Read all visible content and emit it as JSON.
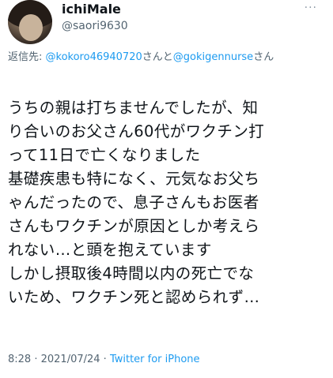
{
  "tweet": {
    "author": {
      "display_name": "ichiMale",
      "handle": "@saori9630"
    },
    "more_label": "···",
    "reply": {
      "prefix": "返信先: ",
      "mention1": "@kokoro46940720",
      "joiner": "さんと",
      "mention2": "@gokigennurse",
      "suffix": "さん"
    },
    "body_lines": [
      "うちの親は打ちませんでしたが、知",
      "り合いのお父さん60代がワクチン打",
      "って11日で亡くなりました",
      "基礎疾患も特になく、元気なお父ち",
      "ゃんだったので、息子さんもお医者",
      "さんもワクチンが原因としか考えら",
      "れない…と頭を抱えています",
      "しかし摂取後4時間以内の死亡でな",
      "いため、ワクチン死と認められず…"
    ],
    "meta": {
      "time": "8:28",
      "separator": " · ",
      "date": "2021/07/24",
      "source": "Twitter for iPhone"
    }
  }
}
